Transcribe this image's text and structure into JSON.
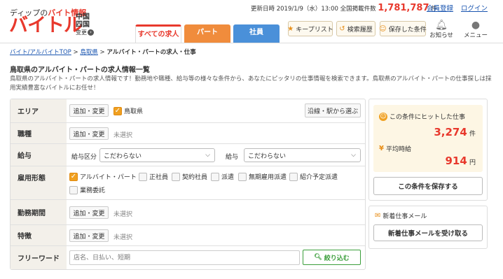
{
  "header": {
    "tagline_prefix": "ディップの",
    "tagline_highlight": "バイト情報",
    "logo": "バイトル",
    "region_line1": "中国",
    "region_line2": "四国",
    "region_sub": "变更",
    "updated_label": "更新日時",
    "updated_date": "2019/1/9（水）13:00 全国掲載件数",
    "total_count": "1,781,787",
    "count_unit": "件",
    "register": "会員登録",
    "login": "ログイン",
    "tabs": [
      {
        "label": "すべての求人"
      },
      {
        "label": "パート"
      },
      {
        "label": "社員"
      }
    ],
    "buttons": [
      {
        "icon": "★",
        "label": "キープリスト"
      },
      {
        "icon": "↺",
        "label": "検索履歴"
      },
      {
        "icon": "☺",
        "label": "保存した条件"
      }
    ],
    "notice": "お知らせ",
    "menu": "メニュー"
  },
  "breadcrumb": {
    "item1": "バイト/アルバイトTOP",
    "item2": "鳥取県",
    "current": "アルバイト・パートの求人・仕事"
  },
  "page_title": "鳥取県のアルバイト・パートの求人情報一覧",
  "description": "鳥取県のアルバイト・パートの求人情報です！勤務地や職種、給与等の様々な条件から、あなたにピッタリの仕事情報を検索できます。鳥取県のアルバイト・パートの仕事探しは採用実績豊富なバイトルにお任せ！",
  "form": {
    "area": {
      "label": "エリア",
      "button": "追加・変更",
      "selected": "鳥取県",
      "line_button": "沿線・駅から選ぶ"
    },
    "job": {
      "label": "職種",
      "button": "追加・変更",
      "value": "未選択"
    },
    "salary": {
      "label": "給与",
      "type_label": "給与区分",
      "type_value": "こだわらない",
      "amount_label": "給与",
      "amount_value": "こだわらない"
    },
    "employment": {
      "label": "雇用形態",
      "options": [
        {
          "label": "アルバイト・パート",
          "checked": true
        },
        {
          "label": "正社員",
          "checked": false
        },
        {
          "label": "契約社員",
          "checked": false
        },
        {
          "label": "派遣",
          "checked": false
        },
        {
          "label": "無期雇用派遣",
          "checked": false
        },
        {
          "label": "紹介予定派遣",
          "checked": false
        },
        {
          "label": "業務委託",
          "checked": false
        }
      ]
    },
    "period": {
      "label": "勤務期間",
      "button": "追加・変更",
      "value": "未選択"
    },
    "feature": {
      "label": "特徴",
      "button": "追加・変更",
      "value": "未選択"
    },
    "freeword": {
      "label": "フリーワード",
      "placeholder": "店名、日払い、短期",
      "search_button": "絞り込む"
    }
  },
  "side": {
    "hit_label": "この条件にヒットした仕事",
    "hit_count": "3,274",
    "hit_unit": "件",
    "avg_label": "平均時給",
    "avg_value": "914",
    "avg_unit": "円",
    "save_button": "この条件を保存する",
    "mail_label": "新着仕事メール",
    "mail_button": "新着仕事メールを受け取る"
  },
  "colors": {
    "brand_red": "#e8392d",
    "tab_all": "#e8392d",
    "tab_part": "#f08c3c",
    "tab_shain": "#4a90d9",
    "check_orange": "#f0a020",
    "search_green": "#3a9e3a"
  }
}
